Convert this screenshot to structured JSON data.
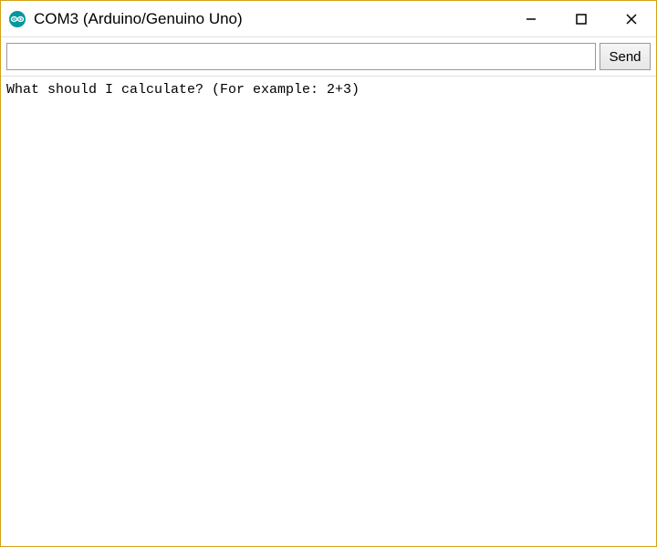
{
  "window": {
    "title": "COM3 (Arduino/Genuino Uno)"
  },
  "input": {
    "value": "",
    "placeholder": ""
  },
  "buttons": {
    "send": "Send"
  },
  "console": {
    "output": "What should I calculate? (For example: 2+3)"
  },
  "icons": {
    "app": "arduino-icon",
    "minimize": "minimize-icon",
    "maximize": "maximize-icon",
    "close": "close-icon"
  }
}
